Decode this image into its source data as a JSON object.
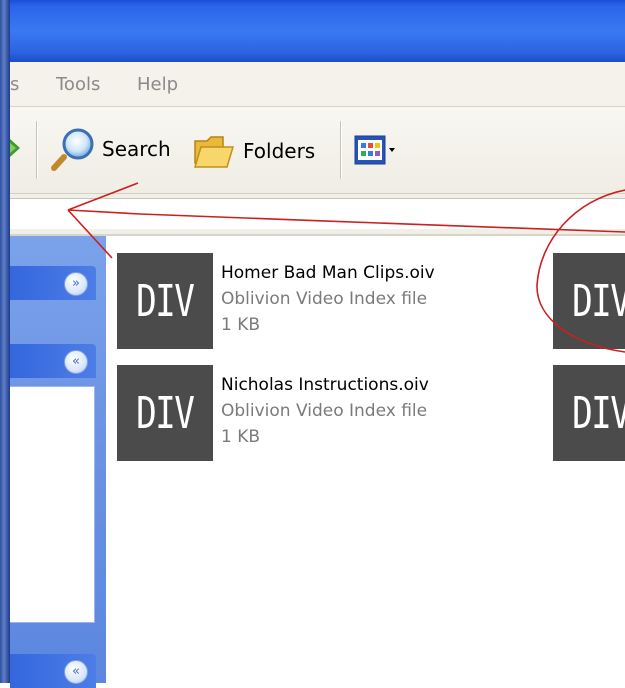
{
  "menu": {
    "items": [
      {
        "label": "s"
      },
      {
        "label": "Tools"
      },
      {
        "label": "Help"
      }
    ]
  },
  "toolbar": {
    "search_label": "Search",
    "folders_label": "Folders"
  },
  "task_pane": {
    "chevrons": [
      "»",
      "«",
      "«"
    ]
  },
  "files": [
    {
      "name": "Homer Bad Man Clips.oiv",
      "type": "Oblivion Video Index file",
      "size": "1 KB",
      "icon_text": "DIV"
    },
    {
      "name": "",
      "type": "",
      "size": "",
      "icon_text": "DIV"
    },
    {
      "name": "Nicholas Instructions.oiv",
      "type": "Oblivion Video Index file",
      "size": "1 KB",
      "icon_text": "DIV"
    },
    {
      "name": "",
      "type": "",
      "size": "",
      "icon_text": "DIV"
    }
  ],
  "colors": {
    "title_bar": "#2a65ea",
    "task_pane": "#6c94e4",
    "annotation_red": "#cc1f1f",
    "file_icon_bg": "#4b4b4b"
  },
  "icons": [
    "back-arrow-icon",
    "search-icon",
    "folders-icon",
    "views-icon",
    "dropdown-arrow-icon"
  ]
}
